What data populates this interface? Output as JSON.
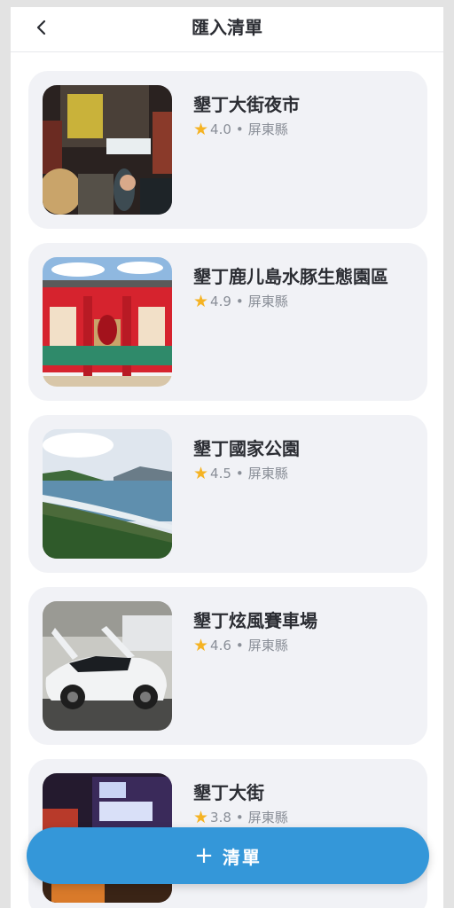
{
  "header": {
    "title": "匯入清單",
    "back_icon": "chevron-left-icon"
  },
  "places": [
    {
      "name": "墾丁大街夜市",
      "rating": "4.0",
      "location": "屏東縣"
    },
    {
      "name": "墾丁鹿儿島水豚生態園區",
      "rating": "4.9",
      "location": "屏東縣"
    },
    {
      "name": "墾丁國家公園",
      "rating": "4.5",
      "location": "屏東縣"
    },
    {
      "name": "墾丁炫風賽車場",
      "rating": "4.6",
      "location": "屏東縣"
    },
    {
      "name": "墾丁大街",
      "rating": "3.8",
      "location": "屏東縣"
    }
  ],
  "separator": "•",
  "fab": {
    "icon": "+",
    "label": "清單"
  },
  "colors": {
    "accent": "#3497d9",
    "star": "#f5b323",
    "card": "#f1f2f6"
  }
}
